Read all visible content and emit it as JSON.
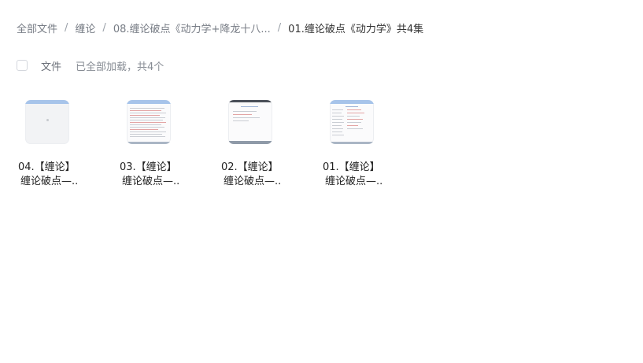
{
  "breadcrumb": {
    "items": [
      "全部文件",
      "缠论",
      "08.缠论破点《动力学+降龙十八..."
    ],
    "separator": "/",
    "current": "01.缠论破点《动力学》共4集"
  },
  "toolbar": {
    "column_label": "文件",
    "status": "已全部加载，共4个"
  },
  "files": [
    {
      "name_line1": "04.【缠论】",
      "name_line2": "缠论破点—..",
      "thumb_style": "blank"
    },
    {
      "name_line1": "03.【缠论】",
      "name_line2": "缠论破点—..",
      "thumb_style": "text-doc"
    },
    {
      "name_line1": "02.【缠论】",
      "name_line2": "缠论破点—..",
      "thumb_style": "sparse-doc"
    },
    {
      "name_line1": "01.【缠论】",
      "name_line2": "缠论破点—..",
      "thumb_style": "column-doc"
    }
  ],
  "colors": {
    "thumb_accent": "#a7c4ea",
    "muted_text": "#878c94"
  }
}
